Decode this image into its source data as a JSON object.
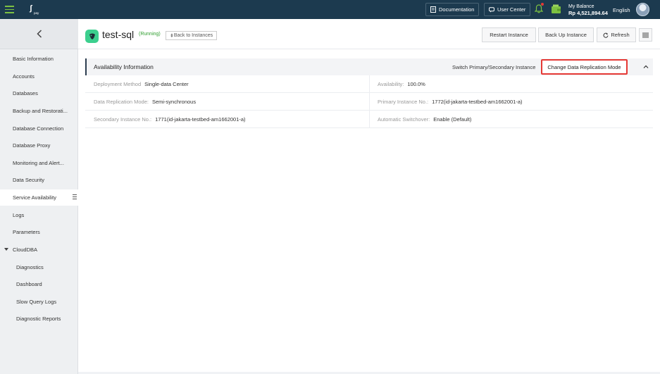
{
  "topbar": {
    "logo_text": "pay",
    "documentation": "Documentation",
    "user_center": "User Center",
    "balance_label": "My Balance",
    "balance_amount": "Rp 4,521,894.64",
    "language": "English"
  },
  "sidebar": {
    "items": [
      {
        "label": "Basic Information"
      },
      {
        "label": "Accounts"
      },
      {
        "label": "Databases"
      },
      {
        "label": "Backup and Restorati..."
      },
      {
        "label": "Database Connection"
      },
      {
        "label": "Database Proxy"
      },
      {
        "label": "Monitoring and Alert..."
      },
      {
        "label": "Data Security"
      },
      {
        "label": "Service Availability"
      },
      {
        "label": "Logs"
      },
      {
        "label": "Parameters"
      },
      {
        "label": "CloudDBA"
      }
    ],
    "sub_items": [
      {
        "label": "Diagnostics"
      },
      {
        "label": "Dashboard"
      },
      {
        "label": "Slow Query Logs"
      },
      {
        "label": "Diagnostic Reports"
      }
    ]
  },
  "header": {
    "instance_name": "test-sql",
    "status": "(Running)",
    "back_label": "Back to Instances",
    "restart": "Restart Instance",
    "backup": "Back Up Instance",
    "refresh": "Refresh"
  },
  "panel": {
    "title": "Availability Information",
    "switch_label": "Switch Primary/Secondary Instance",
    "change_label": "Change Data Replication Mode",
    "rows": [
      {
        "left_key": "Deployment Method",
        "left_val": "Single-data Center",
        "right_key": "Availability:",
        "right_val": "100.0%"
      },
      {
        "left_key": "Data Replication Mode:",
        "left_val": "Semi-synchronous",
        "right_key": "Primary Instance No.:",
        "right_val": "1772(id-jakarta-testbed-am1662001-a)"
      },
      {
        "left_key": "Secondary Instance No.:",
        "left_val": "1771(id-jakarta-testbed-am1662001-a)",
        "right_key": "Automatic Switchover:",
        "right_val": "Enable (Default)"
      }
    ]
  },
  "colors": {
    "topbar": "#1c3a4f",
    "accent_green": "#7dc142",
    "highlight_red": "#e53935",
    "status_green": "#2e9e2e"
  }
}
